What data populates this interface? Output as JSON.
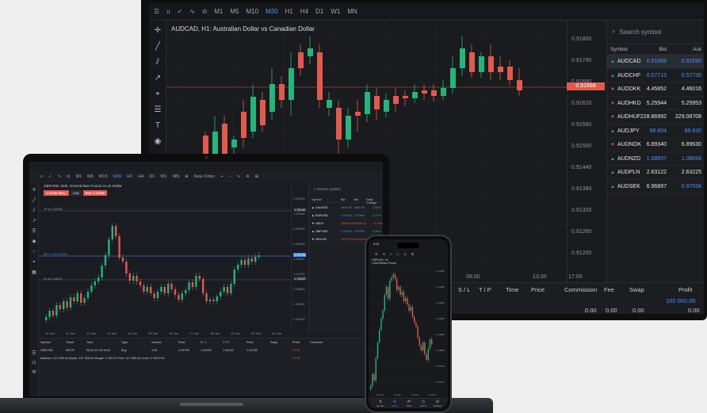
{
  "monitor": {
    "toolbar": [
      "☰",
      "ıı",
      "✓",
      "∿",
      "ılı",
      "M1",
      "M5",
      "M10",
      "M30",
      "H1",
      "H4",
      "D1",
      "W1",
      "MN"
    ],
    "toolbar_selected": 8,
    "tools": [
      "✛",
      "╱",
      "⫽",
      "↗",
      "⌖",
      "☰",
      "T",
      "◉",
      "♢"
    ],
    "chart_title": "AUDCAD, H1: Australian Dollar vs Canadian Dollar",
    "current_price": "0.91668",
    "y_ticks": [
      "0.91800",
      "0.91740",
      "0.91680",
      "0.91620",
      "0.91560",
      "0.91500",
      "0.91440",
      "0.91380",
      "0.91320",
      "0.91260",
      "0.91200"
    ],
    "x_ticks": [
      "08:00",
      "13:00",
      "17:00"
    ],
    "watchlist": {
      "search_placeholder": "Search symbol",
      "headers": {
        "symbol": "Symbol",
        "bid": "Bid",
        "ask": "Ask"
      },
      "rows": [
        {
          "symbol": "AUDCAD",
          "bid": "0.91668",
          "ask": "0.91690",
          "dir": "up",
          "bid_color": "blue",
          "ask_color": "blue"
        },
        {
          "symbol": "AUDCHF",
          "bid": "0.57713",
          "ask": "0.57735",
          "dir": "up",
          "bid_color": "blue",
          "ask_color": "blue"
        },
        {
          "symbol": "AUDDKK",
          "bid": "4.45852",
          "ask": "4.46016",
          "dir": "dn",
          "bid_color": "wht",
          "ask_color": "wht"
        },
        {
          "symbol": "AUDHKD",
          "bid": "5.25944",
          "ask": "5.25953",
          "dir": "dn",
          "bid_color": "wht",
          "ask_color": "wht"
        },
        {
          "symbol": "AUDHUF",
          "bid": "228.86992",
          "ask": "229.08708",
          "dir": "dn",
          "bid_color": "wht",
          "ask_color": "wht"
        },
        {
          "symbol": "AUDJPY",
          "bid": "98.804",
          "ask": "98.830",
          "dir": "up",
          "bid_color": "blue",
          "ask_color": "blue"
        },
        {
          "symbol": "AUDNOK",
          "bid": "6.89340",
          "ask": "6.89630",
          "dir": "dn",
          "bid_color": "wht",
          "ask_color": "wht"
        },
        {
          "symbol": "AUDNZD",
          "bid": "1.08657",
          "ask": "1.08694",
          "dir": "up",
          "bid_color": "blue",
          "ask_color": "blue"
        },
        {
          "symbol": "AUDPLN",
          "bid": "2.63122",
          "ask": "2.63225",
          "dir": "up",
          "bid_color": "wht",
          "ask_color": "wht"
        },
        {
          "symbol": "AUDSEK",
          "bid": "6.96897",
          "ask": "6.97034",
          "dir": "up",
          "bid_color": "wht",
          "ask_color": "blue"
        }
      ]
    },
    "bottom": {
      "headers": [
        "S / L",
        "T / P",
        "Time",
        "Price",
        "Commission",
        "Fee",
        "Swap",
        "Profit"
      ],
      "profit_value": "100 000.00",
      "totals": [
        "0.00",
        "0.00",
        "0.00",
        "0.00"
      ]
    }
  },
  "laptop": {
    "toolbar": [
      "ıı",
      "✓",
      "∿",
      "ılı",
      "M1",
      "M5",
      "M15",
      "M30",
      "H1",
      "H4",
      "D1",
      "W1",
      "MN",
      "⊕",
      "New Order",
      "+",
      "−",
      "∿",
      "ılı",
      "⊞"
    ],
    "toolbar_selected": 7,
    "tools": [
      "✛",
      "╱",
      "⫽",
      "↗",
      "☰",
      "◉",
      "♢",
      "⌖",
      "▦"
    ],
    "bottom_tools": [
      "☰",
      "◷",
      "✉"
    ],
    "chart_title": "GBPUSD, M30: Great Britain Pound vs US Dollar",
    "order": {
      "sell_price": "1.24783",
      "sell_label": "SELL",
      "volume": "1.00",
      "buy_label": "BUY",
      "buy_price": "1.24785"
    },
    "levels": {
      "tp": "TP at 1.25140",
      "buy": "BUY 1 at 1.24794",
      "sl": "SL at 1.24020"
    },
    "level_prices": [
      "1.25140",
      "1.24794",
      "1.24020"
    ],
    "y_ticks": [
      "1.25200",
      "1.25100",
      "1.25000",
      "1.24900",
      "1.24800",
      "1.24700",
      "1.24600",
      "1.24500",
      "1.24400"
    ],
    "x_ticks": [
      "10 Jan",
      "11 Jan",
      "12 Jan",
      "13 Jan",
      "14 Jan",
      "15 Jan",
      "16 Jan",
      "17 Jan",
      "18 Jan",
      "19 Jan",
      "20 Jan",
      "21 Jan"
    ],
    "watch": {
      "search_placeholder": "Search symbol",
      "headers": {
        "symbol": "Symbol",
        "bid": "Bid",
        "ask": "Ask",
        "chg": "Daily Change"
      },
      "rows": [
        {
          "symbol": "XAUUSD",
          "bid": "1946.80",
          "ask": "1946.98",
          "chg": "0.35%",
          "dir": "up"
        },
        {
          "symbol": "EURUSD",
          "bid": "1.07480",
          "ask": "1.07480",
          "chg": "0.17%",
          "dir": "up"
        },
        {
          "symbol": "USDX",
          "bid": "23636.10",
          "ask": "23636.10",
          "chg": "−0.13%",
          "dir": "dn"
        },
        {
          "symbol": "GBPUSD",
          "bid": "1.24783",
          "ask": "1.24785",
          "chg": "0.26%",
          "dir": "up"
        },
        {
          "symbol": "HDX100",
          "bid": "14273.30",
          "ask": "14278.20",
          "chg": "0.32%",
          "dir": "dn"
        }
      ]
    },
    "positions": {
      "headers": [
        "Symbol",
        "Ticket",
        "Time",
        "Type",
        "Volume",
        "Price",
        "S / L",
        "T / P",
        "Price",
        "Swap",
        "Profit",
        "Comment"
      ],
      "row": [
        "GBPUSD",
        "9577ff",
        "06.01.10 15:19:41",
        "Buy",
        "1.00",
        "1.24750",
        "1.24020",
        "1.25140",
        "1.24783",
        "",
        "12.00",
        ""
      ],
      "summary": "Balance: 121 598.3x  Equity: 121 528.5x  Margin: 2 142.22  Free: 117 826.54  Level: 3 249.01%",
      "summary_value": "12.00"
    }
  },
  "phone": {
    "time": "9:41",
    "title": "GBPUSD, H1",
    "subtitle": "Great Britain Pound",
    "y_ticks": [
      "1.17050",
      "1.17000",
      "1.16950",
      "1.16900",
      "1.16850",
      "1.16800",
      "1.16750",
      "1.16700"
    ],
    "x_ticks": [
      "12 Jun",
      "12 Jun",
      "13 Jun",
      "13 Jun"
    ],
    "nav": [
      "Quotes",
      "Chart",
      "Trade",
      "History",
      "Settings"
    ],
    "nav_selected": 1
  },
  "colors": {
    "bull": "#27b37b",
    "bear": "#e05a4f",
    "accent": "#4f8ff7"
  }
}
